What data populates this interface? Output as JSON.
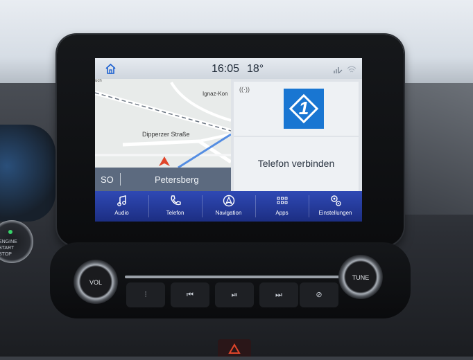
{
  "status": {
    "time": "16:05",
    "temperature": "18°",
    "home_icon": "home-icon",
    "signal_icon": "phone-signal-icon",
    "wifi_icon": "wifi-icon"
  },
  "map": {
    "heading": "SO",
    "location": "Petersberg",
    "street_main": "Dipperzer Straße",
    "street_secondary": "Ignaz-Kon",
    "street_edge": "uch"
  },
  "panel_top": {
    "traffic_icon": "traffic-broadcast-icon",
    "sign_number": "1"
  },
  "panel_bottom": {
    "label": "Telefon verbinden"
  },
  "navbar": {
    "items": [
      {
        "label": "Audio",
        "icon": "music-note-icon"
      },
      {
        "label": "Telefon",
        "icon": "phone-icon"
      },
      {
        "label": "Navigation",
        "icon": "navigation-icon"
      },
      {
        "label": "Apps",
        "icon": "apps-grid-icon"
      },
      {
        "label": "Einstellungen",
        "icon": "settings-gears-icon"
      }
    ]
  },
  "console": {
    "vol_label": "VOL",
    "tune_label": "TUNE"
  },
  "engine": {
    "label_1": "ENGINE",
    "label_2": "START",
    "label_3": "STOP"
  },
  "colors": {
    "navbar": "#243b9c",
    "sign": "#1976d2",
    "arrow": "#e0452a"
  }
}
